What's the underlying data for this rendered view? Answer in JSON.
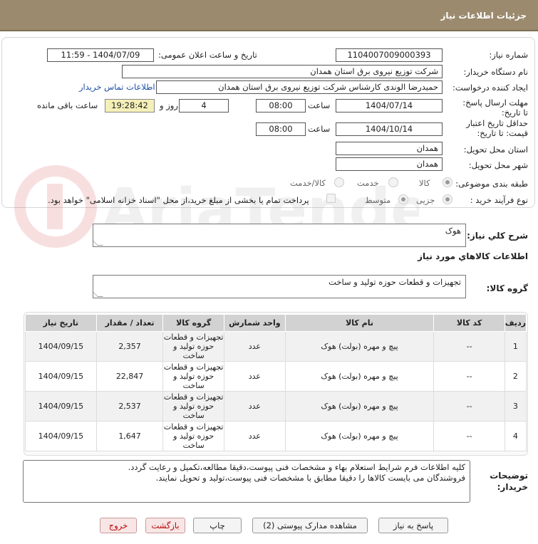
{
  "header": {
    "title": "جزئیات اطلاعات نیاز"
  },
  "form": {
    "need_number_label": "شماره نیاز:",
    "need_number": "1104007009000393",
    "announce_label": "تاریخ و ساعت اعلان عمومی:",
    "announce_value": "1404/07/09 - 11:59",
    "buyer_label": "نام دستگاه خریدار:",
    "buyer_value": "شرکت توزیع نیروی برق استان همدان",
    "creator_label": "ایجاد کننده درخواست:",
    "creator_value": "حمیدرضا الوندی کارشناس شرکت توزیع نیروی برق استان همدان",
    "contact_link": "اطلاعات تماس خریدار",
    "deadline_label": "مهلت ارسال پاسخ: تا تاریخ:",
    "deadline_date": "1404/07/14",
    "time_word": "ساعت",
    "deadline_time": "08:00",
    "days_value": "4",
    "days_word": "روز و",
    "remaining_time": "19:28:42",
    "remaining_label": "ساعت باقی مانده",
    "validity_label": "حداقل تاریخ اعتبار قیمت: تا تاریخ:",
    "validity_date": "1404/10/14",
    "validity_time": "08:00",
    "province_label": "استان محل تحویل:",
    "province_value": "همدان",
    "city_label": "شهر محل تحویل:",
    "city_value": "همدان",
    "category_label": "طبقه بندی موضوعی:",
    "category_options": [
      "کالا",
      "خدمت",
      "کالا/خدمت"
    ],
    "category_selected": "کالا",
    "process_label": "نوع فرآیند خرید :",
    "process_options": [
      "جزیی",
      "متوسط"
    ],
    "process_selected": "جزیی",
    "treasury_text": "پرداخت تمام یا بخشی از مبلغ خرید،از محل \"اسناد خزانه اسلامی\" خواهد بود."
  },
  "summary": {
    "label": "شرح کلي نياز:",
    "value": "هوک"
  },
  "goods_info_title": "اطلاعات کالاهاي مورد نياز",
  "goods_group": {
    "label": "گروه کالا:",
    "value": "تجهیزات و قطعات حوزه تولید و ساخت"
  },
  "table": {
    "headers": [
      "ردیف",
      "کد کالا",
      "نام کالا",
      "واحد شمارش",
      "گروه کالا",
      "تعداد / مقدار",
      "تاریخ نیاز"
    ],
    "rows": [
      {
        "row": "1",
        "code": "--",
        "name": "پیچ و مهره (بولت) هوک",
        "unit": "عدد",
        "group": "تجهیزات و قطعات حوزه تولید و ساخت",
        "qty": "2,357",
        "date": "1404/09/15"
      },
      {
        "row": "2",
        "code": "--",
        "name": "پیچ و مهره (بولت) هوک",
        "unit": "عدد",
        "group": "تجهیزات و قطعات حوزه تولید و ساخت",
        "qty": "22,847",
        "date": "1404/09/15"
      },
      {
        "row": "3",
        "code": "--",
        "name": "پیچ و مهره (بولت) هوک",
        "unit": "عدد",
        "group": "تجهیزات و قطعات حوزه تولید و ساخت",
        "qty": "2,537",
        "date": "1404/09/15"
      },
      {
        "row": "4",
        "code": "--",
        "name": "پیچ و مهره (بولت) هوک",
        "unit": "عدد",
        "group": "تجهیزات و قطعات حوزه تولید و ساخت",
        "qty": "1,647",
        "date": "1404/09/15"
      }
    ]
  },
  "buyer_notes": {
    "label": "توضیحات خریدار:",
    "line1": "کلیه اطلاعات فرم شرایط استعلام بهاء و مشخصات فنی پیوست،دقیقا مطالعه،تکمیل و رعایت گردد.",
    "line2": "فروشندگان می بایست کالاها را دقیقا مطابق با مشخصات فنی پیوست،تولید و تحویل نمایند."
  },
  "buttons": {
    "reply": "پاسخ به نیاز",
    "attachments": "مشاهده مدارک پیوستی (2)",
    "print": "چاپ",
    "back": "بازگشت",
    "exit": "خروج"
  },
  "watermark": "AriaTender.neT",
  "colors": {
    "header": "#9b8a6e",
    "highlight": "#f5f0b8",
    "link": "#1a4fa8",
    "exit": "#bb0000"
  }
}
